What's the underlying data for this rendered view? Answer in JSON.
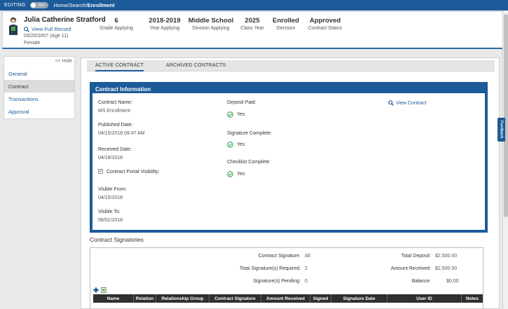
{
  "topbar": {
    "editing_label": "EDITING",
    "toggle_label": "OFF",
    "crumb_home": "Home",
    "crumb_search": "Search",
    "crumb_current": "Enrollment"
  },
  "student": {
    "name": "Julia Catherine Stratford",
    "view_full_record": "View Full Record",
    "dob": "03/20/2007 (Age 11)",
    "gender": "Female"
  },
  "stats": [
    {
      "value": "6",
      "label": "Grade Applying"
    },
    {
      "value": "2018-2019",
      "label": "Year Applying"
    },
    {
      "value": "Middle School",
      "label": "Division Applying"
    },
    {
      "value": "2025",
      "label": "Class Year"
    },
    {
      "value": "Enrolled",
      "label": "Decision"
    },
    {
      "value": "Approved",
      "label": "Contract Status"
    }
  ],
  "sidebar": {
    "hide": "<< Hide",
    "items": [
      {
        "label": "General"
      },
      {
        "label": "Contract"
      },
      {
        "label": "Transactions"
      },
      {
        "label": "Approval"
      }
    ]
  },
  "tabs": [
    {
      "label": "ACTIVE CONTRACT"
    },
    {
      "label": "ARCHIVED CONTRACTS"
    }
  ],
  "contract": {
    "header": "Contract Information",
    "name_label": "Contract Name:",
    "name_value": "MS Enrollment",
    "published_label": "Published Date:",
    "published_value": "04/15/2018 09:47 AM",
    "received_label": "Received Date:",
    "received_value": "04/18/2018",
    "visibility_label": "Contract Portal Visibility:",
    "visible_from_label": "Visible From:",
    "visible_from_value": "04/15/2018",
    "visible_to_label": "Visible To:",
    "visible_to_value": "06/01/2018",
    "deposit_label": "Deposit Paid:",
    "deposit_value": "Yes",
    "signature_label": "Signature Complete:",
    "signature_value": "Yes",
    "checklist_label": "Checklist Complete:",
    "checklist_value": "Yes",
    "view_contract": "View Contract"
  },
  "signatories": {
    "title": "Contract Signatories",
    "contract_signature_label": "Contract Signature:",
    "contract_signature_value": "All",
    "total_required_label": "Total Signature(s) Required:",
    "total_required_value": "2",
    "pending_label": "Signature(s) Pending:",
    "pending_value": "0",
    "total_deposit_label": "Total Deposit:",
    "total_deposit_value": "$2,500.00",
    "amount_received_label": "Amount Received:",
    "amount_received_value": "$2,500.00",
    "balance_label": "Balance:",
    "balance_value": "$0.00",
    "columns": [
      "Name",
      "Relation",
      "Relationship Group",
      "Contract Signature",
      "Amount Received",
      "Signed",
      "Signature Date",
      "User ID",
      "Notes"
    ]
  },
  "feedback": "Feedback",
  "colors": {
    "brand": "#1d5a99",
    "success": "#2e9f49"
  }
}
